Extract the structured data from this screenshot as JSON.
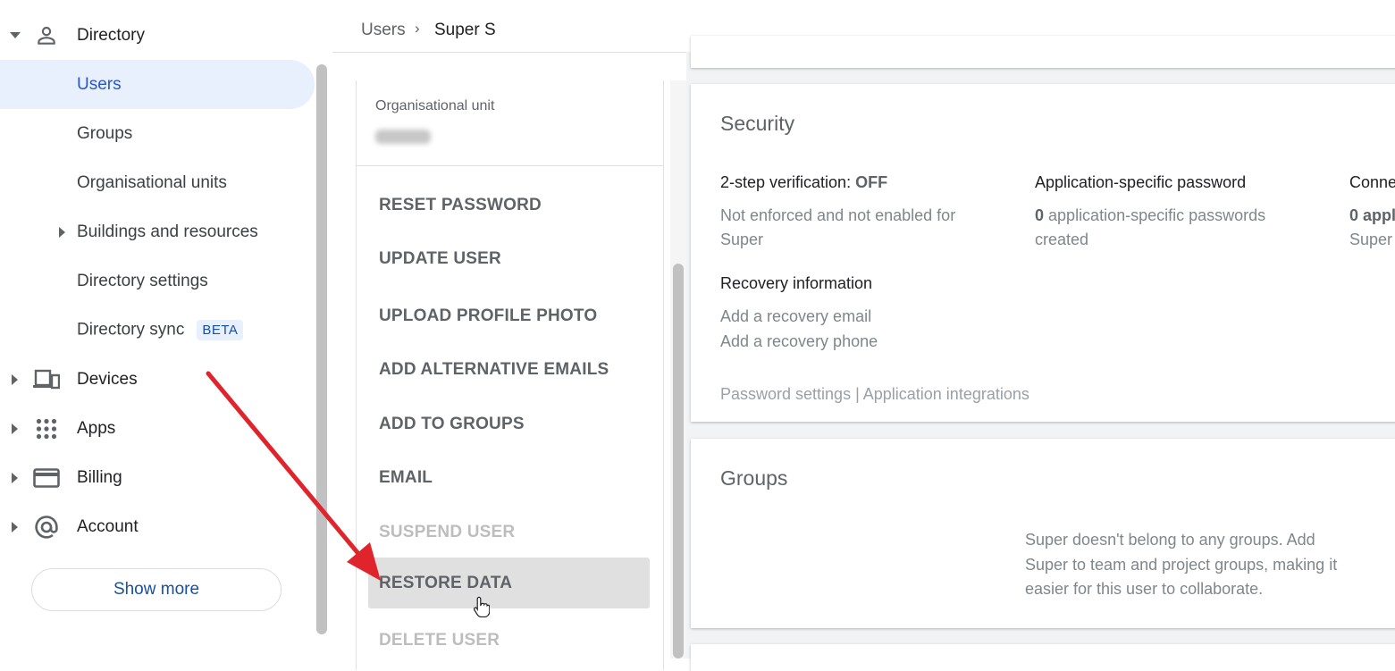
{
  "sidebar": {
    "items": [
      {
        "label": "Directory",
        "icon": "person-icon"
      },
      {
        "label": "Users"
      },
      {
        "label": "Groups"
      },
      {
        "label": "Organisational units"
      },
      {
        "label": "Buildings and resources"
      },
      {
        "label": "Directory settings"
      },
      {
        "label": "Directory sync",
        "badge": "BETA"
      },
      {
        "label": "Devices",
        "icon": "devices-icon"
      },
      {
        "label": "Apps",
        "icon": "apps-grid-icon"
      },
      {
        "label": "Billing",
        "icon": "credit-card-icon"
      },
      {
        "label": "Account",
        "icon": "at-sign-icon"
      }
    ],
    "show_more": "Show more"
  },
  "breadcrumb": {
    "parent": "Users",
    "separator": "›",
    "current": "Super S"
  },
  "actions_panel": {
    "ou_label": "Organisational unit",
    "actions": [
      {
        "label": "RESET PASSWORD",
        "enabled": true
      },
      {
        "label": "UPDATE USER",
        "enabled": true
      },
      {
        "label": "UPLOAD PROFILE PHOTO",
        "enabled": true
      },
      {
        "label": "ADD ALTERNATIVE EMAILS",
        "enabled": true
      },
      {
        "label": "ADD TO GROUPS",
        "enabled": true
      },
      {
        "label": "EMAIL",
        "enabled": true
      },
      {
        "label": "SUSPEND USER",
        "enabled": false
      },
      {
        "label": "RESTORE DATA",
        "enabled": true,
        "hovered": true
      },
      {
        "label": "DELETE USER",
        "enabled": false
      }
    ]
  },
  "security": {
    "title": "Security",
    "two_step_label": "2-step verification:",
    "two_step_value": "OFF",
    "two_step_desc_1": "Not enforced and not enabled for",
    "two_step_desc_2": "Super",
    "app_pw_label": "Application-specific password",
    "app_pw_count": "0",
    "app_pw_desc_1": "application-specific passwords",
    "app_pw_desc_2": "created",
    "connected_label": "Conne",
    "connected_count": "0",
    "connected_desc_1": "appl",
    "connected_desc_2": "Super",
    "recovery_label": "Recovery information",
    "recovery_email": "Add a recovery email",
    "recovery_phone": "Add a recovery phone",
    "links": "Password settings | Application integrations"
  },
  "groups": {
    "title": "Groups",
    "message": "Super doesn't belong to any groups. Add Super to team and project groups, making it easier for this user to collaborate."
  },
  "colors": {
    "active_nav_bg": "#e8f0fe",
    "link_blue": "#1a4fa3",
    "hover_row": "#e0e0e0",
    "annotation_arrow": "#e0242b"
  }
}
